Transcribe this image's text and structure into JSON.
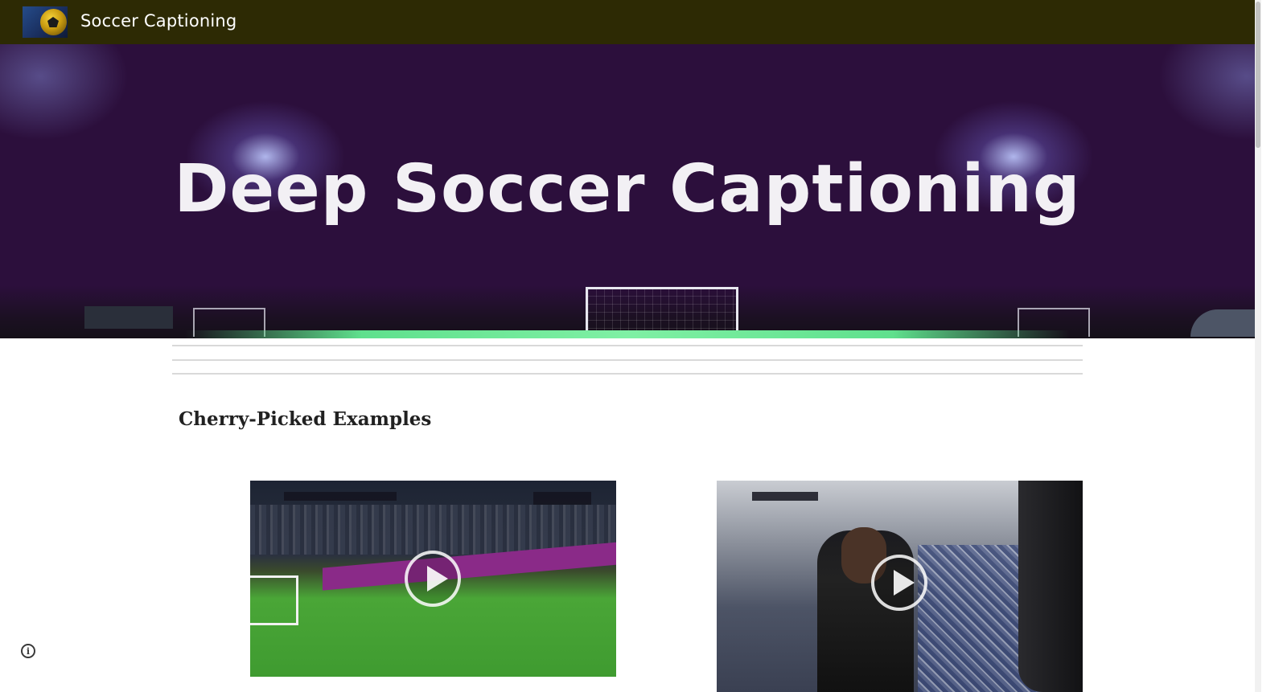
{
  "header": {
    "site_title": "Soccer Captioning",
    "logo_icon": "soccer-ball-logo-icon"
  },
  "hero": {
    "title": "Deep Soccer Captioning"
  },
  "main": {
    "section_heading": "Cherry-Picked Examples",
    "videos": [
      {
        "play_icon": "play-icon"
      },
      {
        "play_icon": "play-icon"
      }
    ]
  },
  "footer": {
    "info_icon": "info-icon",
    "info_glyph": "i"
  },
  "colors": {
    "topbar": "#2d2a04",
    "hero_bg": "#2c0f3c",
    "hero_title": "#f2f0f4",
    "heading": "#212121"
  }
}
